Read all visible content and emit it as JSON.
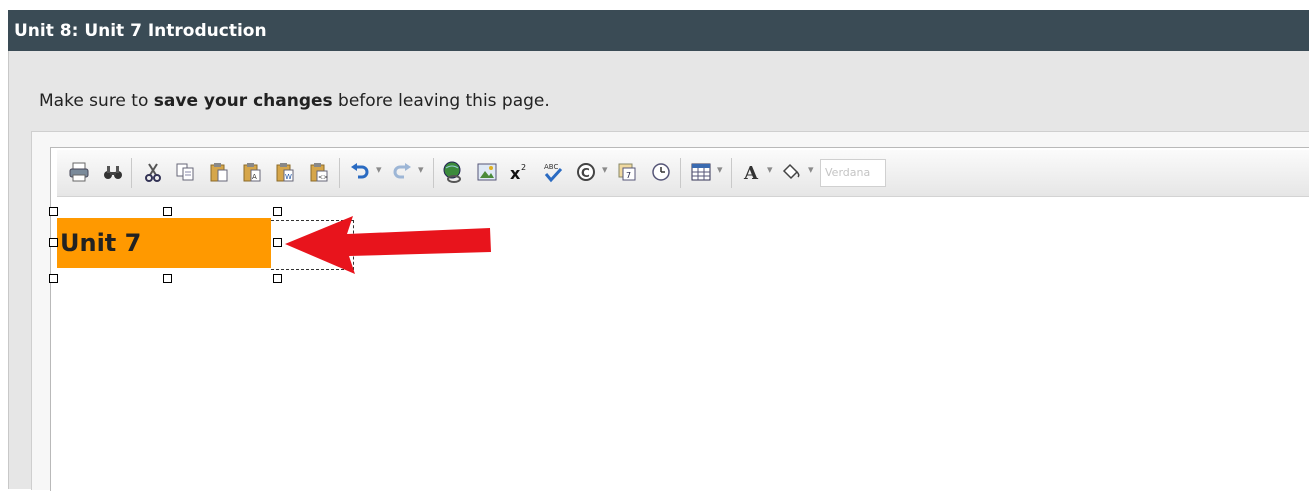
{
  "header": {
    "title": "Unit 8: Unit 7 Introduction"
  },
  "notice": {
    "prefix": "Make sure to ",
    "emphasis": "save your changes",
    "suffix": " before leaving this page."
  },
  "toolbar": {
    "icons": [
      "print-icon",
      "find-icon",
      "cut-icon",
      "copy-icon",
      "paste-icon",
      "paste-text-icon",
      "paste-word-icon",
      "paste-html-icon",
      "undo-icon",
      "redo-icon",
      "hyperlink-icon",
      "image-icon",
      "superscript-icon",
      "spellcheck-icon",
      "copyright-icon",
      "date-icon",
      "time-icon",
      "table-icon",
      "font-color-icon",
      "background-color-icon"
    ],
    "font_select_value": "Verdana"
  },
  "editor": {
    "selected_text": "Unit 7",
    "highlight_color": "#ff9900"
  },
  "colors": {
    "header_bg": "#3a4b55",
    "annotation_arrow": "#e8141c"
  }
}
